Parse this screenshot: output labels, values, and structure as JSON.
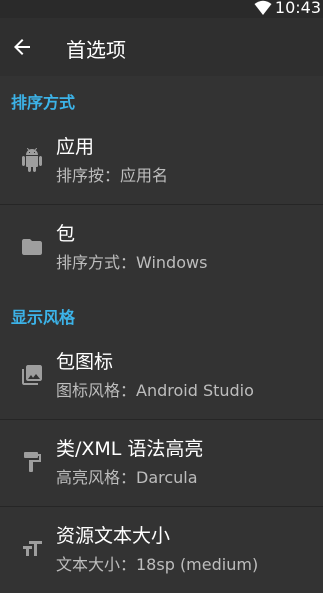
{
  "status_bar": {
    "time": "10:43",
    "wifi_icon": "wifi-icon"
  },
  "app_bar": {
    "back_icon": "arrow-back-icon",
    "title": "首选项"
  },
  "sections": [
    {
      "header": "排序方式",
      "items": [
        {
          "icon": "android-icon",
          "title": "应用",
          "summary": "排序按：应用名"
        },
        {
          "icon": "folder-icon",
          "title": "包",
          "summary": "排序方式：Windows"
        }
      ]
    },
    {
      "header": "显示风格",
      "items": [
        {
          "icon": "photo-library-icon",
          "title": "包图标",
          "summary": "图标风格：Android Studio"
        },
        {
          "icon": "format-paint-icon",
          "title": "类/XML 语法高亮",
          "summary": "高亮风格：Darcula"
        },
        {
          "icon": "text-size-icon",
          "title": "资源文本大小",
          "summary": "文本大小：18sp (medium)"
        }
      ]
    }
  ],
  "colors": {
    "accent": "#3cb3e8",
    "background": "#333333",
    "app_bar": "#2f2f2f"
  }
}
